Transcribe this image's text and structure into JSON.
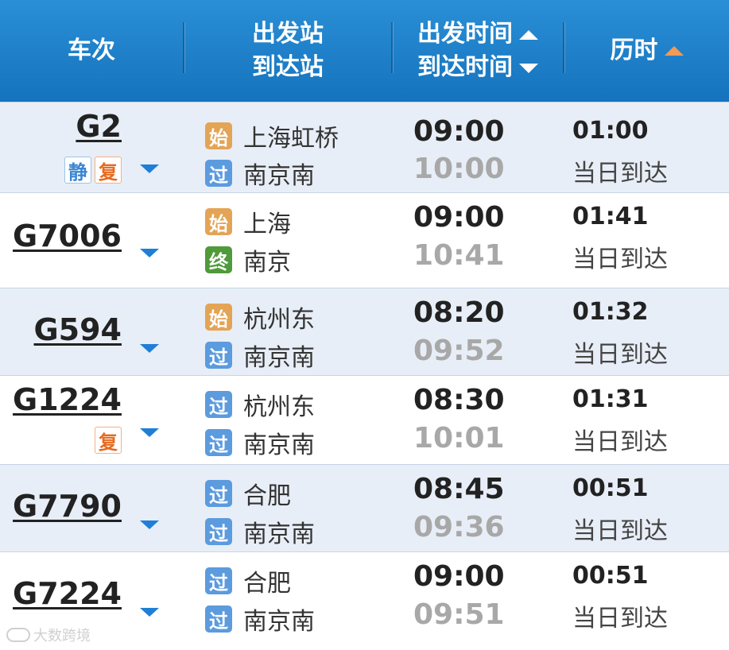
{
  "header": {
    "train": "车次",
    "from": "出发站",
    "to": "到达站",
    "dep_time": "出发时间",
    "arr_time": "到达时间",
    "duration": "历时"
  },
  "rows": [
    {
      "train": "G2",
      "badges": [
        "静",
        "复"
      ],
      "from_icon": "始",
      "from": "上海虹桥",
      "to_icon": "过",
      "to": "南京南",
      "dep": "09:00",
      "arr": "10:00",
      "duration": "01:00",
      "arrival": "当日到达"
    },
    {
      "train": "G7006",
      "badges": [],
      "from_icon": "始",
      "from": "上海",
      "to_icon": "终",
      "to": "南京",
      "dep": "09:00",
      "arr": "10:41",
      "duration": "01:41",
      "arrival": "当日到达"
    },
    {
      "train": "G594",
      "badges": [],
      "from_icon": "始",
      "from": "杭州东",
      "to_icon": "过",
      "to": "南京南",
      "dep": "08:20",
      "arr": "09:52",
      "duration": "01:32",
      "arrival": "当日到达"
    },
    {
      "train": "G1224",
      "badges": [
        "复"
      ],
      "from_icon": "过",
      "from": "杭州东",
      "to_icon": "过",
      "to": "南京南",
      "dep": "08:30",
      "arr": "10:01",
      "duration": "01:31",
      "arrival": "当日到达"
    },
    {
      "train": "G7790",
      "badges": [],
      "from_icon": "过",
      "from": "合肥",
      "to_icon": "过",
      "to": "南京南",
      "dep": "08:45",
      "arr": "09:36",
      "duration": "00:51",
      "arrival": "当日到达"
    },
    {
      "train": "G7224",
      "badges": [],
      "from_icon": "过",
      "from": "合肥",
      "to_icon": "过",
      "to": "南京南",
      "dep": "09:00",
      "arr": "09:51",
      "duration": "00:51",
      "arrival": "当日到达"
    }
  ],
  "watermark": "大数跨境",
  "colors": {
    "header_top": "#2a8fd6",
    "header_bottom": "#1573bd",
    "row_alt": "#e8eef7",
    "start_icon": "#e3a456",
    "pass_icon": "#5b9bde",
    "end_icon": "#4f9a3a",
    "sort_active": "#f39a54",
    "expand_arrow": "#1f7fd6"
  },
  "icons": {
    "sort_up": "triangle-up-icon",
    "sort_down": "triangle-down-icon",
    "expand": "chevron-down-icon"
  }
}
